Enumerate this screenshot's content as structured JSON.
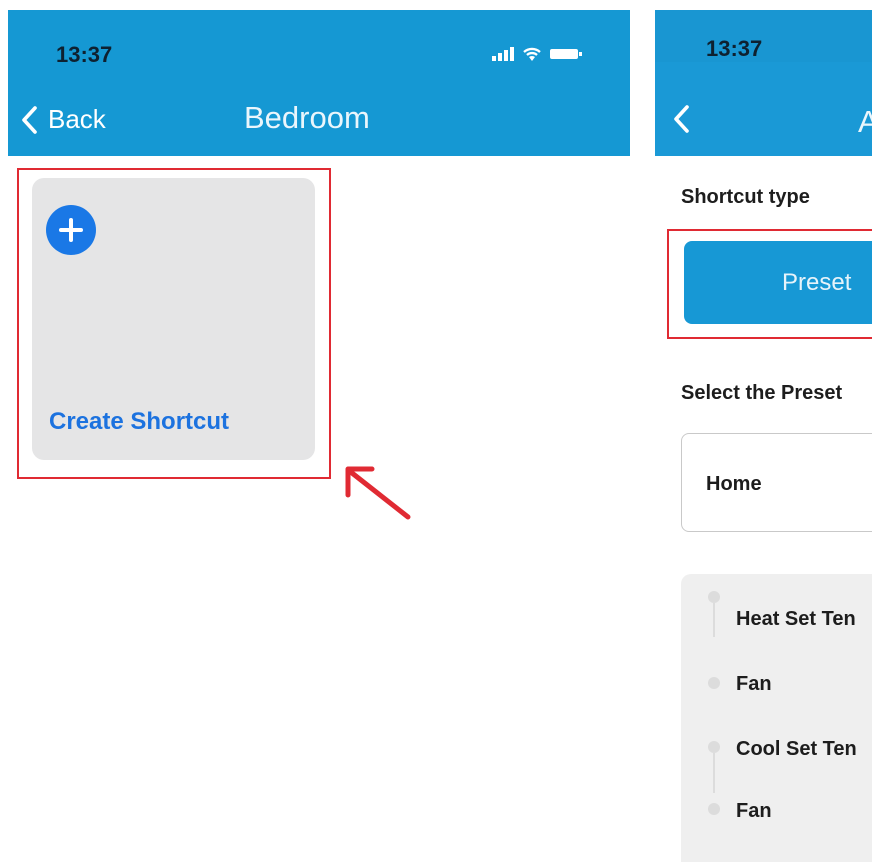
{
  "left_screen": {
    "status_time": "13:37",
    "back_label": "Back",
    "title": "Bedroom",
    "shortcut_card": {
      "label": "Create Shortcut"
    }
  },
  "right_screen": {
    "status_time": "13:37",
    "title_partial": "A",
    "shortcut_type_label": "Shortcut type",
    "preset_button_label": "Preset",
    "select_preset_label": "Select the Preset",
    "selected_preset": "Home",
    "preset_items": [
      "Heat Set Ten",
      "Fan",
      "Cool Set Ten",
      "Fan"
    ]
  },
  "colors": {
    "header_blue": "#1598d3",
    "accent_blue": "#1a78e6",
    "highlight_red": "#e02a33"
  }
}
